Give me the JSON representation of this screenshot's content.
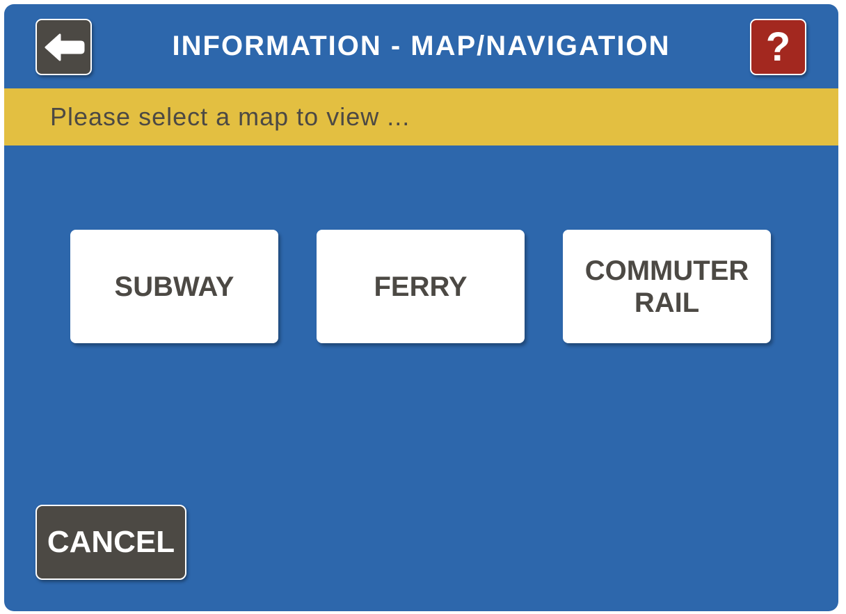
{
  "header": {
    "title": "INFORMATION - MAP/NAVIGATION",
    "back_icon": "arrow-left-icon",
    "help_icon": "question-mark-icon",
    "help_label": "?"
  },
  "prompt": {
    "text": "Please select a map to view ..."
  },
  "map_options": [
    {
      "label": "SUBWAY"
    },
    {
      "label": "FERRY"
    },
    {
      "label": "COMMUTER RAIL"
    }
  ],
  "footer": {
    "cancel_label": "CANCEL"
  },
  "colors": {
    "background": "#2d67ac",
    "prompt_bar": "#e3bf41",
    "dark_button": "#4c4944",
    "help_button": "#a3281f",
    "option_button": "#ffffff"
  }
}
